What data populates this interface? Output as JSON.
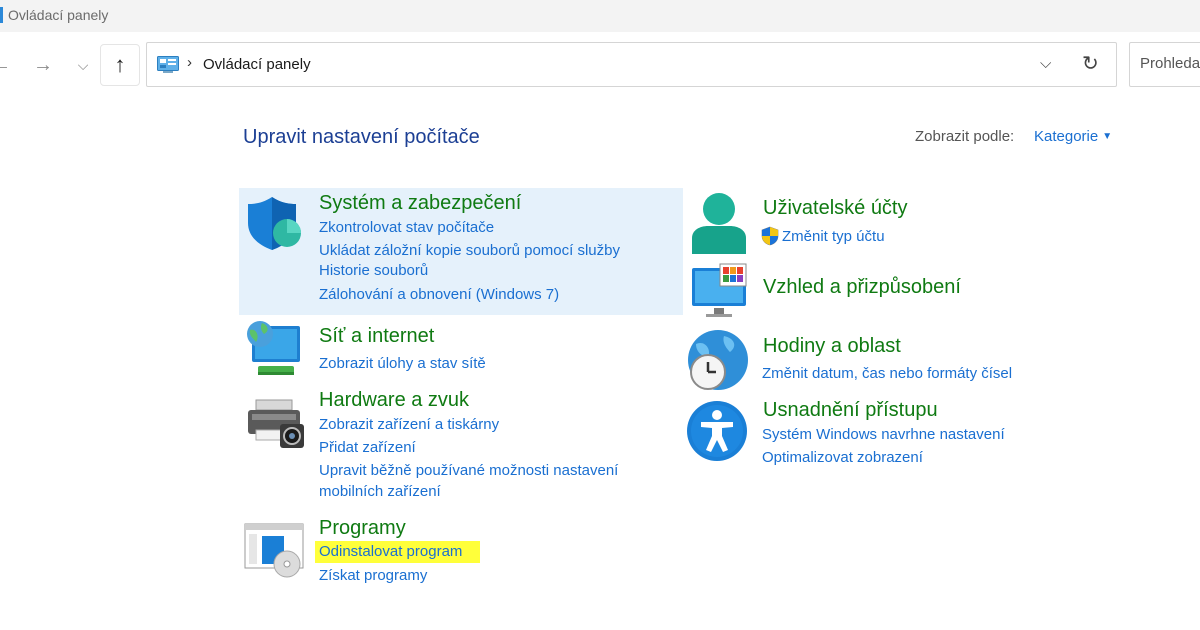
{
  "window": {
    "title": "Ovládací panely"
  },
  "toolbar": {
    "back_glyph": "←",
    "forward_glyph": "→",
    "recent_glyph": "⌵",
    "up_glyph": "↑",
    "breadcrumb_sep": "›",
    "path": "Ovládací panely",
    "dropdown_glyph": "⌵",
    "refresh_glyph": "↻",
    "search_placeholder": "Prohledat"
  },
  "main": {
    "title": "Upravit nastavení počítače",
    "view_by_label": "Zobrazit podle:",
    "view_by_value": "Kategorie",
    "view_caret": "▼"
  },
  "categories": {
    "system": {
      "heading": "Systém a zabezpečení",
      "links": [
        "Zkontrolovat stav počítače",
        "Ukládat záložní kopie souborů pomocí služby",
        "Historie souborů",
        "Zálohování a obnovení (Windows 7)"
      ]
    },
    "network": {
      "heading": "Síť a internet",
      "links": [
        "Zobrazit úlohy a stav sítě"
      ]
    },
    "hardware": {
      "heading": "Hardware a zvuk",
      "links": [
        "Zobrazit zařízení a tiskárny",
        "Přidat zařízení",
        "Upravit běžně používané možnosti nastavení",
        "mobilních zařízení"
      ]
    },
    "programs": {
      "heading": "Programy",
      "links": [
        "Odinstalovat program",
        "Získat programy"
      ]
    },
    "accounts": {
      "heading": "Uživatelské účty",
      "links": [
        "Změnit typ účtu"
      ]
    },
    "appearance": {
      "heading": "Vzhled a přizpůsobení"
    },
    "clock": {
      "heading": "Hodiny a oblast",
      "links": [
        "Změnit datum, čas nebo formáty čísel"
      ]
    },
    "access": {
      "heading": "Usnadnění přístupu",
      "links": [
        "Systém Windows navrhne nastavení",
        "Optimalizovat zobrazení"
      ]
    }
  },
  "colors": {
    "heading_green": "#0f7a12",
    "link_blue": "#1a6fd1",
    "title_blue": "#1c3f94",
    "selected_bg": "#e5f1fb",
    "highlight_yellow": "#ffff3a"
  },
  "icons": {
    "system": "shield-icon",
    "network": "network-monitor-icon",
    "hardware": "printer-camera-icon",
    "programs": "programs-disc-icon",
    "accounts": "user-icon",
    "appearance": "appearance-monitor-icon",
    "clock": "globe-clock-icon",
    "access": "accessibility-icon",
    "uac": "uac-shield-icon"
  }
}
